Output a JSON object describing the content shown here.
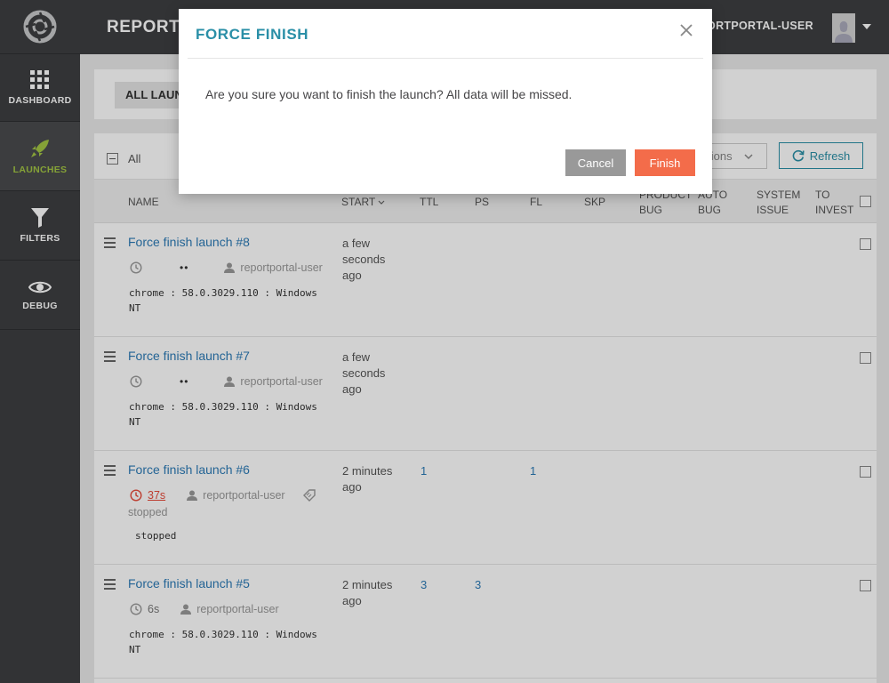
{
  "header": {
    "project_title": "REPORTPORTAL",
    "user_name": "REPORTPORTAL-USER"
  },
  "sidebar": {
    "items": [
      {
        "label": "DASHBOARD",
        "icon": "grid-icon"
      },
      {
        "label": "LAUNCHES",
        "icon": "rocket-icon",
        "active": true
      },
      {
        "label": "FILTERS",
        "icon": "filter-icon"
      },
      {
        "label": "DEBUG",
        "icon": "eye-icon"
      }
    ]
  },
  "filter_bar": {
    "tab_label": "ALL LAUNCHES"
  },
  "toolbar": {
    "select_all_label": "All",
    "actions_label": "Actions",
    "refresh_label": "Refresh"
  },
  "table": {
    "columns": {
      "name": "NAME",
      "start": "START",
      "ttl": "TTL",
      "ps": "PS",
      "fl": "FL",
      "skp": "SKP",
      "product_bug_1": "PRODUCT",
      "product_bug_2": "BUG",
      "auto_bug_1": "AUTO",
      "auto_bug_2": "BUG",
      "system_issue_1": "SYSTEM",
      "system_issue_2": "ISSUE",
      "to_invest_1": "TO",
      "to_invest_2": "INVEST"
    },
    "rows": [
      {
        "name": "Force finish launch #8",
        "duration": "",
        "dots": "••",
        "owner": "reportportal-user",
        "platform_1": "chrome : 58.0.3029.110 : Windows",
        "platform_2": "NT",
        "start_1": "a few",
        "start_2": "seconds",
        "start_3": "ago",
        "ttl": "",
        "ps": "",
        "fl": ""
      },
      {
        "name": "Force finish launch #7",
        "duration": "",
        "dots": "••",
        "owner": "reportportal-user",
        "platform_1": "chrome : 58.0.3029.110 : Windows",
        "platform_2": "NT",
        "start_1": "a few",
        "start_2": "seconds",
        "start_3": "ago",
        "ttl": "",
        "ps": "",
        "fl": ""
      },
      {
        "name": "Force finish launch #6",
        "duration": "37s",
        "status": "stopped",
        "owner": "reportportal-user",
        "description": "stopped",
        "start_1": "2 minutes",
        "start_2": "ago",
        "ttl": "1",
        "ps": "",
        "fl": "1"
      },
      {
        "name": "Force finish launch #5",
        "duration": "6s",
        "owner": "reportportal-user",
        "platform_1": "chrome : 58.0.3029.110 : Windows",
        "platform_2": "NT",
        "start_1": "2 minutes",
        "start_2": "ago",
        "ttl": "3",
        "ps": "3",
        "fl": ""
      }
    ]
  },
  "modal": {
    "title": "FORCE FINISH",
    "message": "Are you sure you want to finish the launch? All data will be missed.",
    "cancel_label": "Cancel",
    "finish_label": "Finish"
  },
  "colors": {
    "accent": "#2a8fa7",
    "finish": "#f36c4a",
    "link": "#2c7bb6",
    "active_nav": "#a3c644",
    "error": "#e74c3c"
  }
}
